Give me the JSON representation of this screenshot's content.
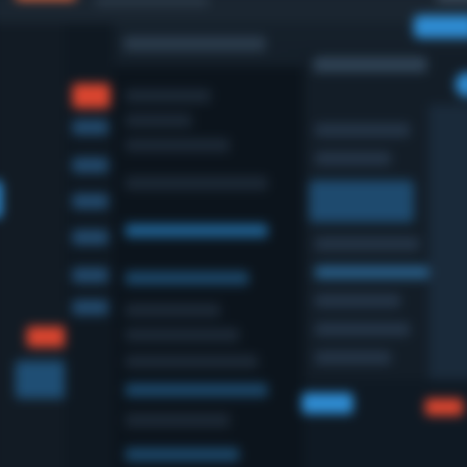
{
  "window": {
    "title": ""
  },
  "colors": {
    "background": "#101820",
    "accent_orange": "#e2673f",
    "accent_red": "#d9452f",
    "accent_blue": "#2e8bd1",
    "selection_blue": "#1f5f8f"
  },
  "icons": {
    "brand": "logo-icon",
    "action": "settings-icon"
  },
  "explorer": {
    "items": [
      {
        "icon": "file-icon",
        "state": "active"
      },
      {
        "icon": "file-icon",
        "state": "normal"
      },
      {
        "icon": "file-icon",
        "state": "normal"
      },
      {
        "icon": "file-icon",
        "state": "normal"
      },
      {
        "icon": "file-icon",
        "state": "normal"
      },
      {
        "icon": "file-icon",
        "state": "normal"
      }
    ]
  },
  "editor": {
    "lines": [
      {
        "tone": "dim"
      },
      {
        "tone": "dim"
      },
      {
        "tone": "dim"
      },
      {
        "tone": "dim"
      },
      {
        "tone": "selected"
      },
      {
        "tone": "blue"
      },
      {
        "tone": "dim"
      },
      {
        "tone": "dim"
      },
      {
        "tone": "dim"
      },
      {
        "tone": "blue"
      },
      {
        "tone": "dim"
      },
      {
        "tone": "blue"
      }
    ]
  },
  "sidepanel": {
    "rows": [
      {
        "tone": "dim"
      },
      {
        "tone": "dim"
      },
      {
        "tone": "dim"
      },
      {
        "tone": "highlight"
      },
      {
        "tone": "dim"
      },
      {
        "tone": "dim"
      },
      {
        "tone": "dim"
      }
    ]
  },
  "status": {
    "chip_state": "active",
    "alert_state": "error"
  }
}
